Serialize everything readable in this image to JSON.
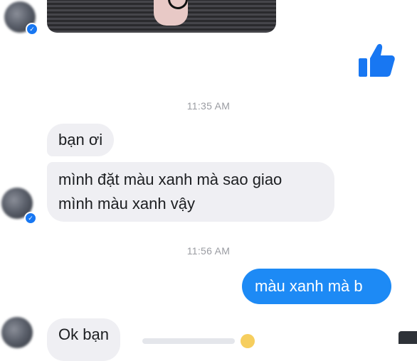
{
  "conversation": {
    "timestamps": [
      "11:35 AM",
      "11:56 AM"
    ],
    "messages_group1": [
      "bạn ơi",
      "mình đặt màu xanh mà sao giao mình màu xanh vậy"
    ],
    "message_line1": "mình đặt màu xanh mà sao giao",
    "message_line2": "mình màu xanh vậy",
    "outgoing_message": "màu xanh mà b",
    "reply_partial": "Ok bạn"
  },
  "icons": [
    "avatar",
    "verified-badge-icon",
    "like-thumb-icon",
    "reaction-emoji-icon"
  ],
  "colors": {
    "outgoing_bubble": "#1d8af5",
    "incoming_bubble": "#efeff3",
    "like": "#1877f2"
  }
}
